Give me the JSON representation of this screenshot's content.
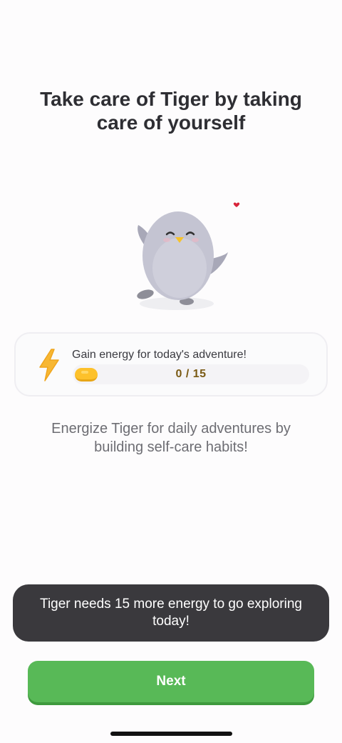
{
  "title": "Take care of Tiger by taking care of yourself",
  "mascot": {
    "icon": "penguin-mascot-icon",
    "heart_icon": "heart-icon"
  },
  "energy": {
    "label": "Gain energy for today's adventure!",
    "progress_text": "0 / 15",
    "current": 0,
    "goal": 15,
    "bolt_icon": "lightning-bolt-icon",
    "coin_icon": "energy-coin-icon"
  },
  "subtitle": "Energize Tiger for daily adventures by building self-care habits!",
  "toast": {
    "text": "Tiger needs 15 more energy to go exploring today!"
  },
  "next_button": {
    "label": "Next"
  },
  "colors": {
    "accent_green": "#58b957",
    "energy_yellow": "#fdc12b",
    "toast_bg": "#3a393d"
  }
}
